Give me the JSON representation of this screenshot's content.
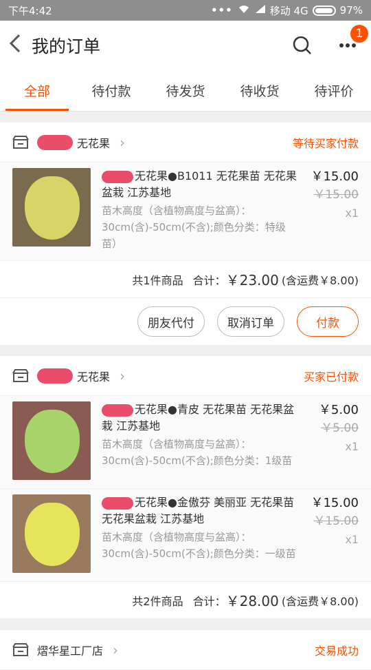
{
  "status_bar": {
    "time": "下午4:42",
    "signal_dots": "•••",
    "carrier": "移动 4G",
    "battery": "97%"
  },
  "header": {
    "title": "我的订单",
    "badge": "1",
    "back_icon": "back-icon",
    "search_icon": "search-icon",
    "more_icon": "more-icon"
  },
  "tabs": [
    {
      "label": "全部",
      "active": true
    },
    {
      "label": "待付款"
    },
    {
      "label": "待发货"
    },
    {
      "label": "待收货"
    },
    {
      "label": "待评价"
    }
  ],
  "orders": [
    {
      "shop": "无花果",
      "status": "等待买家付款",
      "items": [
        {
          "title": "无花果●B1011 无花果苗 无花果盆栽 江苏基地",
          "spec": "苗木高度（含植物高度与盆高）：30cm(含)-50cm(不含);颜色分类：特级苗）",
          "price": "￥15.00",
          "orig": "￥15.00",
          "qty": "x1",
          "color": "#d8d468"
        }
      ],
      "count": "共1件商品",
      "total_label": "合计：",
      "total": "￥23.00",
      "shipping": "(含运费￥8.00)",
      "buttons": [
        "朋友代付",
        "取消订单",
        "付款"
      ]
    },
    {
      "shop": "无花果",
      "status": "买家已付款",
      "items": [
        {
          "title": "无花果●青皮 无花果苗 无花果盆栽 江苏基地",
          "spec": "苗木高度（含植物高度与盆高）：30cm(含)-50cm(不含);颜色分类：1级苗",
          "price": "￥5.00",
          "orig": "￥5.00",
          "qty": "x1",
          "color": "#a7d36a"
        },
        {
          "title": "无花果●金傲芬 美丽亚 无花果苗 无花果盆栽 江苏基地",
          "spec": "苗木高度（含植物高度与盆高）：30cm(含)-50cm(不含);颜色分类：一级苗",
          "price": "￥15.00",
          "orig": "￥15.00",
          "qty": "x1",
          "color": "#e6e45a"
        }
      ],
      "count": "共2件商品",
      "total_label": "合计：",
      "total": "￥28.00",
      "shipping": "(含运费￥8.00)"
    },
    {
      "shop": "熠华星工厂店",
      "status": "交易成功"
    }
  ]
}
